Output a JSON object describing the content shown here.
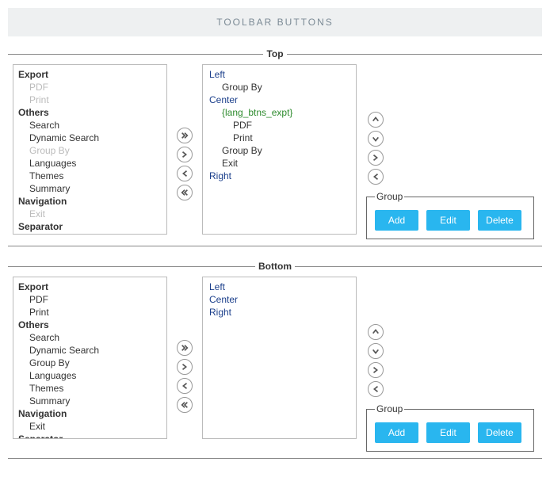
{
  "banner": "TOOLBAR BUTTONS",
  "sections": {
    "top": {
      "legend": "Top",
      "source": {
        "groups": [
          {
            "head": "Export",
            "items": [
              {
                "label": "PDF",
                "disabled": true
              },
              {
                "label": "Print",
                "disabled": true
              }
            ]
          },
          {
            "head": "Others",
            "items": [
              {
                "label": "Search"
              },
              {
                "label": "Dynamic Search"
              },
              {
                "label": "Group By",
                "disabled": true
              },
              {
                "label": "Languages"
              },
              {
                "label": "Themes"
              },
              {
                "label": "Summary"
              }
            ]
          },
          {
            "head": "Navigation",
            "items": [
              {
                "label": "Exit",
                "disabled": true
              }
            ]
          },
          {
            "head": "Separator",
            "items": [
              {
                "label": "------------------------",
                "sep": true
              }
            ]
          }
        ]
      },
      "target": [
        {
          "label": "Left",
          "type": "root"
        },
        {
          "label": "Group By",
          "type": "child"
        },
        {
          "label": "Center",
          "type": "root"
        },
        {
          "label": "{lang_btns_expt}",
          "type": "green"
        },
        {
          "label": "PDF",
          "type": "sub"
        },
        {
          "label": "Print",
          "type": "sub"
        },
        {
          "label": "Group By",
          "type": "child"
        },
        {
          "label": "Exit",
          "type": "child"
        },
        {
          "label": "Right",
          "type": "root"
        }
      ]
    },
    "bottom": {
      "legend": "Bottom",
      "source": {
        "groups": [
          {
            "head": "Export",
            "items": [
              {
                "label": "PDF"
              },
              {
                "label": "Print"
              }
            ]
          },
          {
            "head": "Others",
            "items": [
              {
                "label": "Search"
              },
              {
                "label": "Dynamic Search"
              },
              {
                "label": "Group By"
              },
              {
                "label": "Languages"
              },
              {
                "label": "Themes"
              },
              {
                "label": "Summary"
              }
            ]
          },
          {
            "head": "Navigation",
            "items": [
              {
                "label": "Exit"
              }
            ]
          },
          {
            "head": "Separator",
            "items": [
              {
                "label": "------------------------",
                "sep": true
              }
            ]
          }
        ]
      },
      "target": [
        {
          "label": "Left",
          "type": "root"
        },
        {
          "label": "Center",
          "type": "root"
        },
        {
          "label": "Right",
          "type": "root"
        }
      ]
    }
  },
  "groupBox": {
    "legend": "Group",
    "add": "Add",
    "edit": "Edit",
    "delete": "Delete"
  }
}
